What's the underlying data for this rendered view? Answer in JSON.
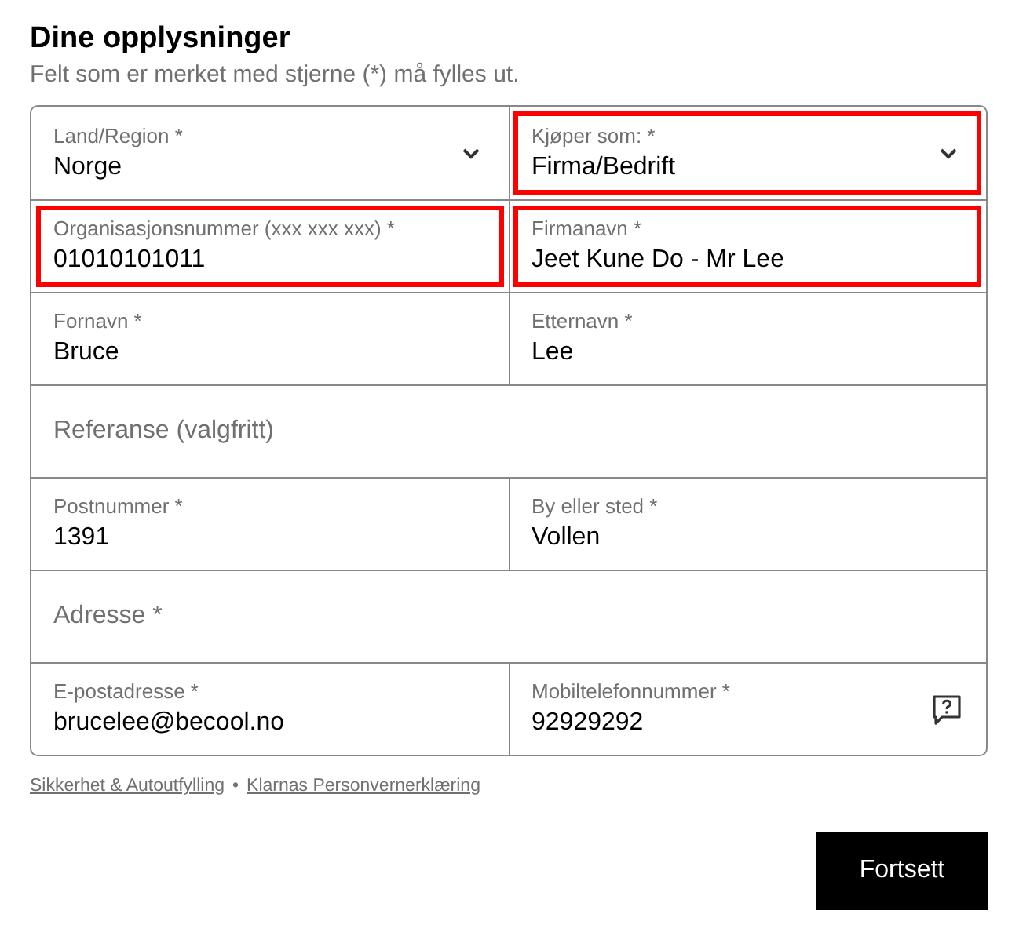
{
  "title": "Dine opplysninger",
  "subtitle": "Felt som er merket med stjerne (*) må fylles ut.",
  "rows": [
    {
      "fields": [
        {
          "kind": "select",
          "label": "Land/Region *",
          "value": "Norge",
          "highlighted": false
        },
        {
          "kind": "select",
          "label": "Kjøper som: *",
          "value": "Firma/Bedrift",
          "highlighted": true
        }
      ]
    },
    {
      "fields": [
        {
          "kind": "text",
          "label": "Organisasjonsnummer (xxx xxx xxx) *",
          "value": "01010101011",
          "highlighted": true
        },
        {
          "kind": "text",
          "label": "Firmanavn *",
          "value": "Jeet Kune Do - Mr Lee",
          "highlighted": true
        }
      ]
    },
    {
      "fields": [
        {
          "kind": "text",
          "label": "Fornavn *",
          "value": "Bruce",
          "highlighted": false
        },
        {
          "kind": "text",
          "label": "Etternavn *",
          "value": "Lee",
          "highlighted": false
        }
      ]
    },
    {
      "fields": [
        {
          "kind": "text",
          "placeholder": "Referanse (valgfritt)",
          "highlighted": false
        }
      ]
    },
    {
      "fields": [
        {
          "kind": "text",
          "label": "Postnummer *",
          "value": "1391",
          "highlighted": false
        },
        {
          "kind": "text",
          "label": "By eller sted *",
          "value": "Vollen",
          "highlighted": false
        }
      ]
    },
    {
      "fields": [
        {
          "kind": "text",
          "placeholder": "Adresse *",
          "highlighted": false
        }
      ]
    },
    {
      "fields": [
        {
          "kind": "text",
          "label": "E-postadresse *",
          "value": "brucelee@becool.no",
          "highlighted": false
        },
        {
          "kind": "help",
          "label": "Mobiltelefonnummer *",
          "value": "92929292",
          "highlighted": false
        }
      ]
    }
  ],
  "links": [
    "Sikkerhet & Autoutfylling",
    "Klarnas Personvernerklæring"
  ],
  "separator": "•",
  "button": "Fortsett"
}
